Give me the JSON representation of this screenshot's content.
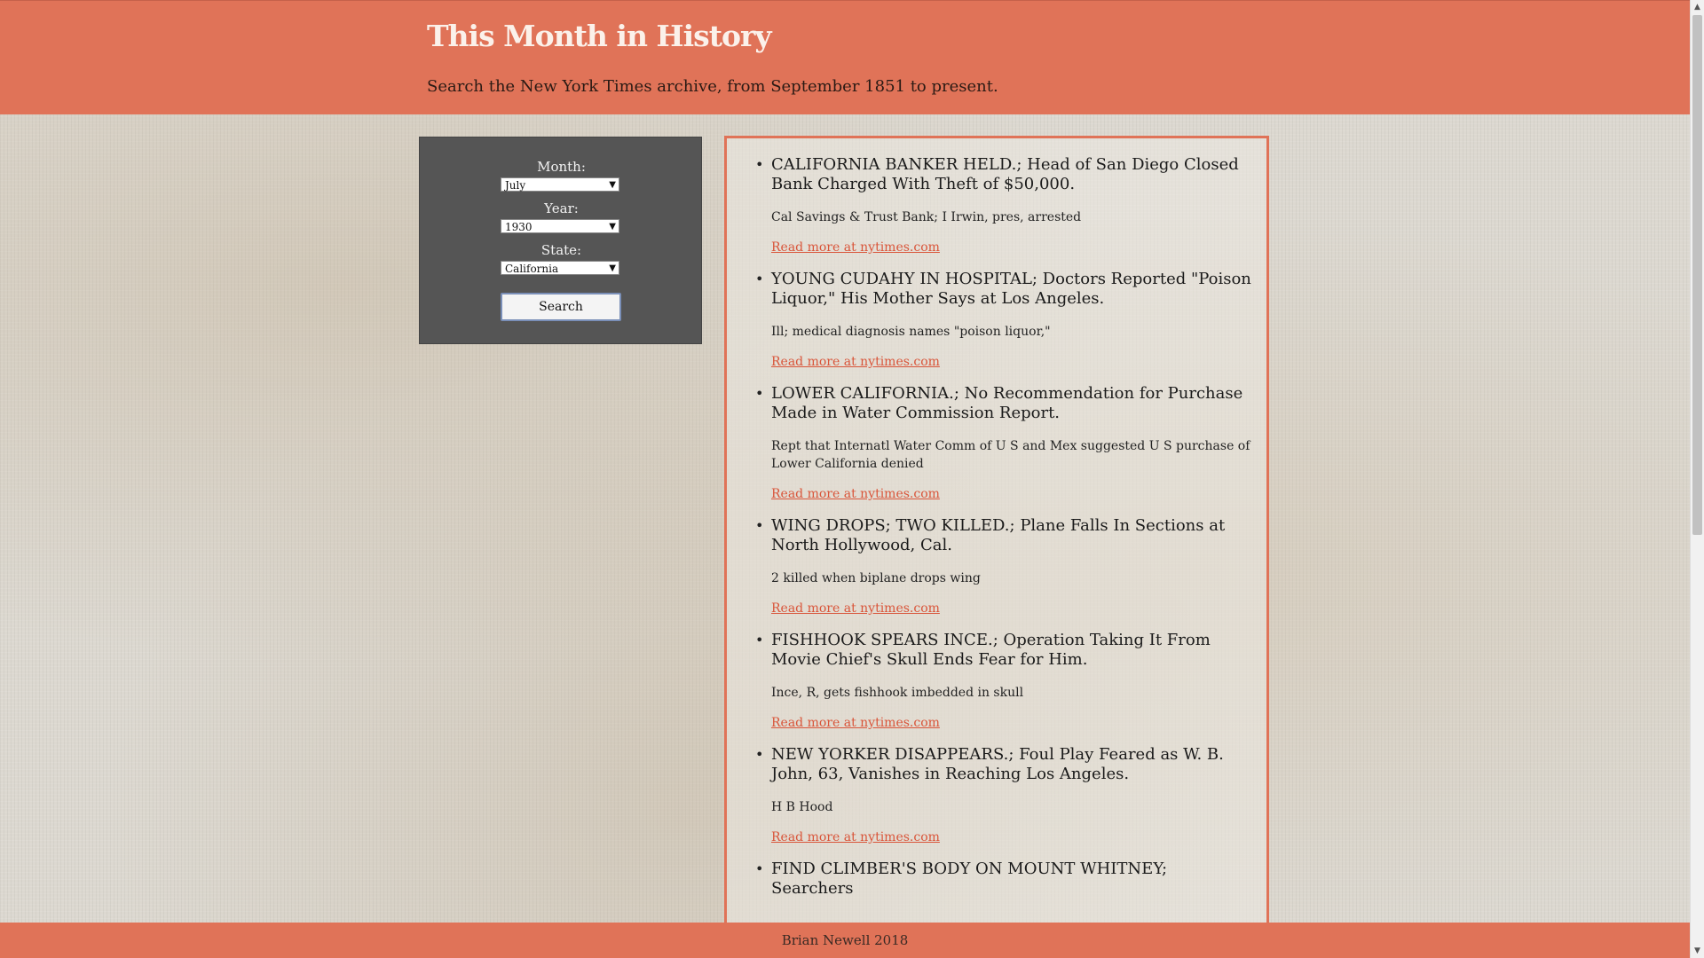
{
  "header": {
    "title": "This Month in History",
    "subtitle": "Search the New York Times archive, from September 1851 to present."
  },
  "search": {
    "month_label": "Month:",
    "month_value": "July",
    "year_label": "Year:",
    "year_value": "1930",
    "state_label": "State:",
    "state_value": "California",
    "button_label": "Search"
  },
  "articles": [
    {
      "title": "CALIFORNIA BANKER HELD.; Head of San Diego Closed Bank Charged With Theft of $50,000.",
      "summary": "Cal Savings & Trust Bank; I Irwin, pres, arrested",
      "link": "Read more at nytimes.com"
    },
    {
      "title": "YOUNG CUDAHY IN HOSPITAL; Doctors Reported \"Poison Liquor,\" His Mother Says at Los Angeles.",
      "summary": "Ill; medical diagnosis names \"poison liquor,\"",
      "link": "Read more at nytimes.com"
    },
    {
      "title": "LOWER CALIFORNIA.; No Recommendation for Purchase Made in Water Commission Report.",
      "summary": "Rept that Internatl Water Comm of U S and Mex suggested U S purchase of Lower California denied",
      "link": "Read more at nytimes.com"
    },
    {
      "title": "WING DROPS; TWO KILLED.; Plane Falls In Sections at North Hollywood, Cal.",
      "summary": "2 killed when biplane drops wing",
      "link": "Read more at nytimes.com"
    },
    {
      "title": "FISHHOOK SPEARS INCE.; Operation Taking It From Movie Chief's Skull Ends Fear for Him.",
      "summary": "Ince, R, gets fishhook imbedded in skull",
      "link": "Read more at nytimes.com"
    },
    {
      "title": "NEW YORKER DISAPPEARS.; Foul Play Feared as W. B. John, 63, Vanishes in Reaching Los Angeles.",
      "summary": "H B Hood",
      "link": "Read more at nytimes.com"
    },
    {
      "title": "FIND CLIMBER'S BODY ON MOUNT WHITNEY; Searchers",
      "summary": "",
      "link": ""
    }
  ],
  "footer": {
    "text": "Brian Newell 2018"
  },
  "colors": {
    "accent": "#e07358",
    "panel": "#555555",
    "link": "#d9553a"
  },
  "icons": {
    "select_caret": "triangle-down",
    "scroll_up": "arrow-up",
    "scroll_down": "arrow-down"
  }
}
